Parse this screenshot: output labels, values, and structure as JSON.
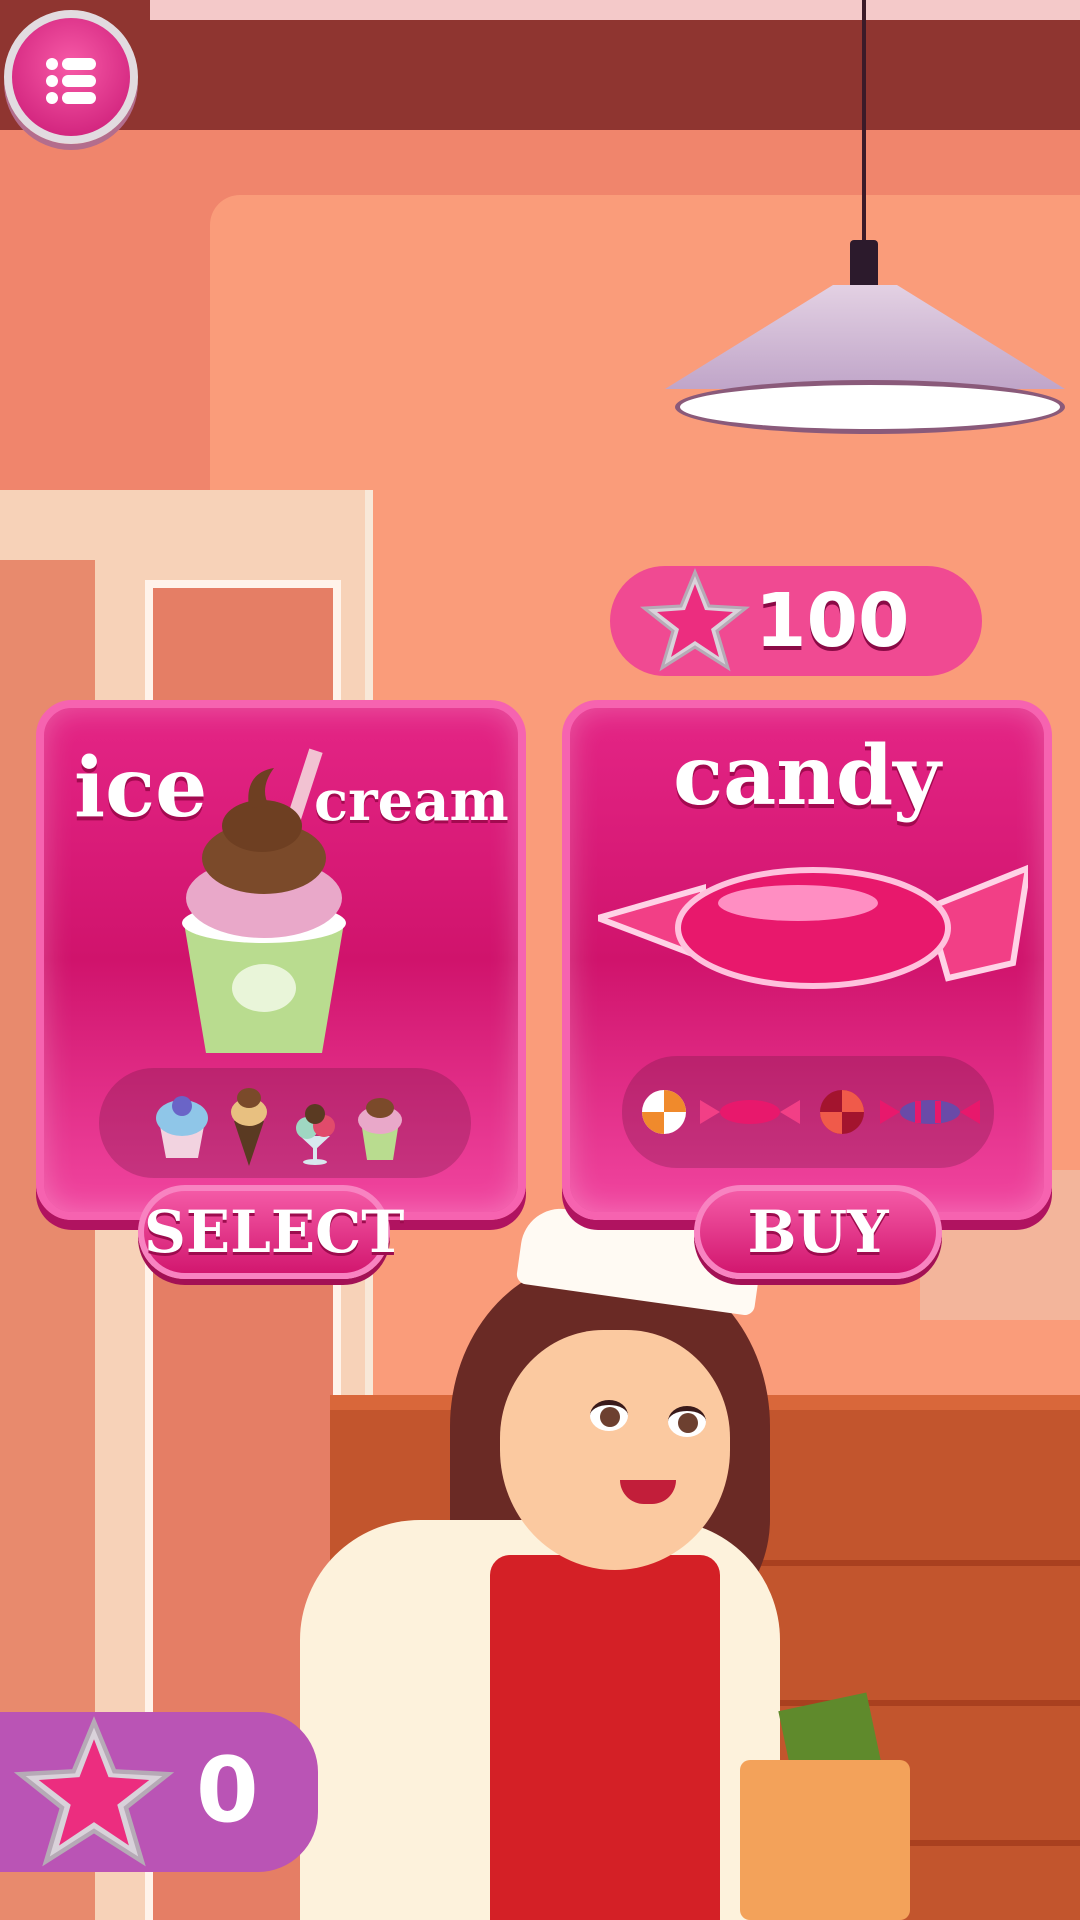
{
  "colors": {
    "brand_pink": "#e42586",
    "accent_light": "#f663b0",
    "score_panel": "#ba54b5"
  },
  "menu": {
    "icon": "menu-dots-icon"
  },
  "cards": [
    {
      "title_part1": "ice",
      "title_part2": "cream",
      "button_label": "SELECT",
      "variants": [
        "blueberry-cupcake",
        "cone",
        "sundae-glass",
        "cupcake"
      ]
    },
    {
      "title": "candy",
      "button_label": "BUY",
      "price": "100",
      "variants": [
        "swirl-candy",
        "wrapped-candy",
        "swirl-candy",
        "striped-wrapped-candy"
      ]
    }
  ],
  "score": {
    "value": "0",
    "icon": "star-icon"
  }
}
